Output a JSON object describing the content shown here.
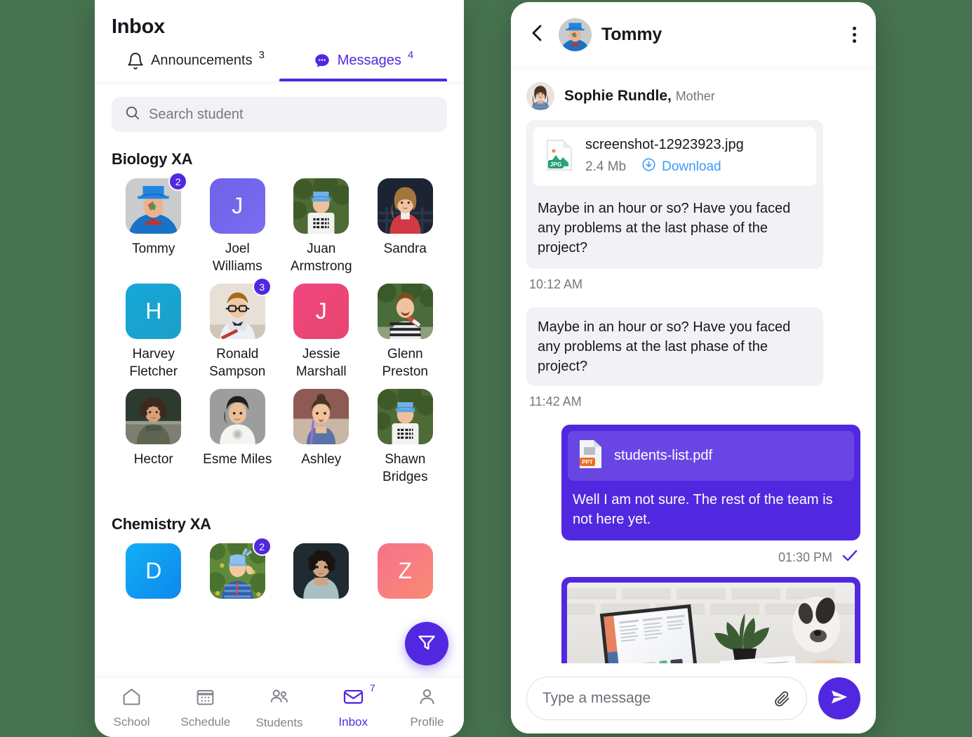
{
  "colors": {
    "accent": "#5128e0",
    "background": "#477350",
    "link": "#3b9cf5",
    "muted": "#75777f",
    "bubble_in": "#f1f1f6"
  },
  "inbox": {
    "title": "Inbox",
    "tabs": [
      {
        "label": "Announcements",
        "badge": "3",
        "icon": "bell-icon",
        "active": false
      },
      {
        "label": "Messages",
        "badge": "4",
        "icon": "chat-bubble-icon",
        "active": true
      }
    ],
    "search": {
      "placeholder": "Search student",
      "icon": "search-icon"
    },
    "fab": {
      "icon": "filter-icon"
    },
    "classes": [
      {
        "title": "Biology XA",
        "students": [
          {
            "name": "Tommy",
            "type": "photo",
            "photo": "boy-blue-hat",
            "badge": "2"
          },
          {
            "name": "Joel Williams",
            "type": "initial",
            "initial": "J",
            "color1": "#6f62e8",
            "color2": "#7a6df0",
            "badge": ""
          },
          {
            "name": "Juan Armstrong",
            "type": "photo",
            "photo": "boy-cap-tree",
            "badge": ""
          },
          {
            "name": "Sandra",
            "type": "photo",
            "photo": "girl-red-coat",
            "badge": ""
          },
          {
            "name": "Harvey Fletcher",
            "type": "initial",
            "initial": "H",
            "color1": "#16a8d8",
            "color2": "#1c9fc9",
            "badge": ""
          },
          {
            "name": "Ronald Sampson",
            "type": "photo",
            "photo": "boy-glasses",
            "badge": "3"
          },
          {
            "name": "Jessie Marshall",
            "type": "initial",
            "initial": "J",
            "color1": "#f0477f",
            "color2": "#e8456f",
            "badge": ""
          },
          {
            "name": "Glenn Preston",
            "type": "photo",
            "photo": "boy-stripes",
            "badge": ""
          },
          {
            "name": "Hector",
            "type": "photo",
            "photo": "curly-kid",
            "badge": ""
          },
          {
            "name": "Esme Miles",
            "type": "photo",
            "photo": "boy-grey-bg",
            "badge": ""
          },
          {
            "name": "Ashley",
            "type": "photo",
            "photo": "girl-bun",
            "badge": ""
          },
          {
            "name": "Shawn Bridges",
            "type": "photo",
            "photo": "boy-cap-tree",
            "badge": ""
          }
        ]
      },
      {
        "title": "Chemistry XA",
        "students": [
          {
            "name": "",
            "type": "initial",
            "initial": "D",
            "color1": "#13b0f5",
            "color2": "#0d87ee",
            "badge": ""
          },
          {
            "name": "",
            "type": "photo",
            "photo": "boy-bandana",
            "badge": "2"
          },
          {
            "name": "",
            "type": "photo",
            "photo": "dark-portrait",
            "badge": ""
          },
          {
            "name": "",
            "type": "initial",
            "initial": "Z",
            "color1": "#f6718d",
            "color2": "#f98a72",
            "badge": ""
          }
        ]
      }
    ],
    "bottom_nav": [
      {
        "label": "School",
        "icon": "home-icon",
        "badge": "",
        "active": false
      },
      {
        "label": "Schedule",
        "icon": "calendar-icon",
        "badge": "",
        "active": false
      },
      {
        "label": "Students",
        "icon": "people-icon",
        "badge": "",
        "active": false
      },
      {
        "label": "Inbox",
        "icon": "envelope-icon",
        "badge": "7",
        "active": true
      },
      {
        "label": "Profile",
        "icon": "person-icon",
        "badge": "",
        "active": false
      }
    ]
  },
  "chat": {
    "header": {
      "back_icon": "chevron-left-icon",
      "avatar": "boy-blue-hat",
      "title": "Tommy",
      "menu_icon": "kebab-menu-icon"
    },
    "sender": {
      "name": "Sophie Rundle,",
      "role": "Mother",
      "avatar": "woman-portrait"
    },
    "messages": [
      {
        "direction": "in",
        "attachment": {
          "kind": "file",
          "icon": "jpg-file-icon",
          "name": "screenshot-12923923.jpg",
          "size": "2.4 Mb",
          "action_label": "Download",
          "action_icon": "download-circle-icon"
        },
        "text": "Maybe in an hour or so? Have you faced any problems at the last phase of the project?",
        "time": "10:12 AM"
      },
      {
        "direction": "in",
        "text": "Maybe in an hour or so? Have you faced any problems at the last phase of the project?",
        "time": "11:42 AM"
      },
      {
        "direction": "out",
        "attachment": {
          "kind": "file",
          "icon": "ppt-file-icon",
          "name": "students-list.pdf"
        },
        "text": "Well I am not sure. The rest of the team is not here yet.",
        "time": "01:30 PM",
        "status_icon": "checkmark-icon"
      },
      {
        "direction": "out",
        "attachment": {
          "kind": "image",
          "photo": "laptop-desk-photo"
        }
      }
    ],
    "composer": {
      "placeholder": "Type a message",
      "value": "",
      "clip_icon": "paperclip-icon",
      "send_icon": "send-icon"
    }
  }
}
